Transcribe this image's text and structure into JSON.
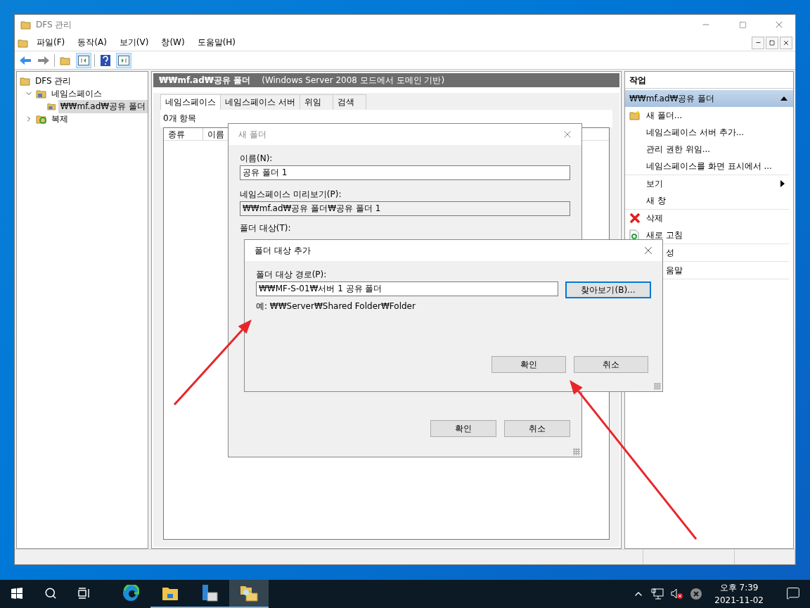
{
  "window": {
    "title": "DFS 관리"
  },
  "menu": [
    "파일(F)",
    "동작(A)",
    "보기(V)",
    "창(W)",
    "도움말(H)"
  ],
  "tree": [
    {
      "label": "DFS 관리",
      "selected": false,
      "children": [
        {
          "label": "네임스페이스",
          "selected": false,
          "expanded": true,
          "children": [
            {
              "label": "₩₩mf.ad₩공유 폴더",
              "selected": true
            }
          ]
        },
        {
          "label": "복제",
          "selected": false,
          "expanded": false
        }
      ]
    }
  ],
  "center": {
    "title": "₩₩mf.ad₩공유 폴더",
    "subtitle": "(Windows Server 2008 모드에서 도메인 기반)",
    "tabs": [
      {
        "label": "네임스페이스",
        "selected": true
      },
      {
        "label": "네임스페이스 서버",
        "selected": false
      },
      {
        "label": "위임",
        "selected": false
      },
      {
        "label": "검색",
        "selected": false
      }
    ],
    "count": "0개 항목",
    "columns": [
      "종류",
      "이름"
    ]
  },
  "actions": {
    "title": "작업",
    "section": "₩₩mf.ad₩공유 폴더",
    "groups": [
      [
        {
          "label": "새 폴더...",
          "kind": "new-folder"
        },
        {
          "label": "네임스페이스 서버 추가...",
          "kind": "plain"
        },
        {
          "label": "관리 권한 위임...",
          "kind": "plain"
        },
        {
          "label": "네임스페이스를 화면 표시에서 ...",
          "kind": "plain"
        }
      ],
      [
        {
          "label": "보기",
          "kind": "submenu"
        },
        {
          "label": "새 창",
          "kind": "plain"
        }
      ],
      [
        {
          "label": "삭제",
          "kind": "delete"
        },
        {
          "label": "새로 고침",
          "kind": "refresh"
        }
      ],
      [
        {
          "label": "성",
          "kind": "covered"
        }
      ],
      [
        {
          "label": "움말",
          "kind": "covered"
        }
      ]
    ]
  },
  "new_folder_dialog": {
    "title": "새 폴더",
    "name_label": "이름(N):",
    "name_value": "공유 폴더 1",
    "preview_label": "네임스페이스 미리보기(P):",
    "preview_value": "₩₩mf.ad₩공유 폴더₩공유 폴더 1",
    "targets_label": "폴더 대상(T):",
    "buttons": [
      "확인",
      "취소"
    ]
  },
  "add_target_dialog": {
    "title": "폴더 대상 추가",
    "path_label": "폴더 대상 경로(P):",
    "path_value": "₩₩MF-S-01₩서버 1 공유 폴더",
    "browse": "찾아보기(B)...",
    "example": "예: ₩₩Server₩Shared Folder₩Folder",
    "buttons": [
      "확인",
      "취소"
    ]
  },
  "taskbar": {
    "apps": [
      {
        "kind": "edge",
        "running": false,
        "selected": false
      },
      {
        "kind": "explorer",
        "running": true,
        "selected": false
      },
      {
        "kind": "server-manager",
        "running": true,
        "selected": false
      },
      {
        "kind": "dfs",
        "running": true,
        "selected": true
      }
    ],
    "time": "오후 7:39",
    "date": "2021-11-02"
  }
}
